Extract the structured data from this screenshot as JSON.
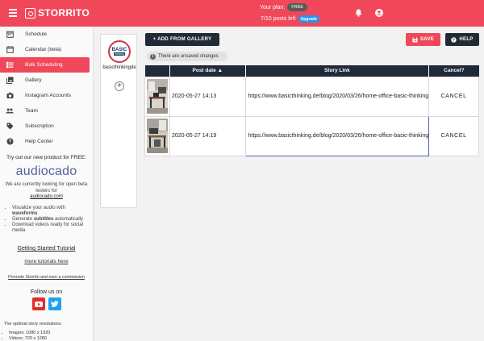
{
  "app": {
    "brand": "STORRITO"
  },
  "topbar": {
    "plan_label": "Your plan:",
    "plan_badge": "FREE",
    "posts_left": "7/10 posts left",
    "upgrade_label": "Upgrade",
    "accent": "#f0485a"
  },
  "sidebar": {
    "items": [
      {
        "label": "Schedule",
        "icon": "schedule-icon"
      },
      {
        "label": "Calendar (beta)",
        "icon": "calendar-icon"
      },
      {
        "label": "Bulk Scheduling",
        "icon": "list-icon",
        "active": true
      },
      {
        "label": "Gallery",
        "icon": "gallery-icon"
      },
      {
        "label": "Instagram Accounts",
        "icon": "camera-icon"
      },
      {
        "label": "Team",
        "icon": "team-icon"
      },
      {
        "label": "Subscription",
        "icon": "tag-icon"
      },
      {
        "label": "Help Center",
        "icon": "help-icon"
      }
    ],
    "promo": {
      "title": "Try out our new product for FREE:",
      "logo_text": "audiocado",
      "text": "We are currently looking for open beta testers for",
      "link": "audiocado.com",
      "bullets": [
        {
          "pre": "Visualize your audio with ",
          "bold": "waveforms",
          "post": ""
        },
        {
          "pre": "Generate ",
          "bold": "subtitles",
          "post": " automatically"
        },
        {
          "pre": "Download videos ready for social media",
          "bold": "",
          "post": ""
        }
      ]
    },
    "getting_started": "Getting Started Tutorial",
    "more_tutorials": "more tutorials here",
    "promote": "Promote Storrito and earn a commission",
    "follow_us": "Follow us on",
    "resolutions_title": "The optimal story resolutions:",
    "resolutions": [
      "Images: 1080 x 1920",
      "Videos: 720 x 1280"
    ]
  },
  "account": {
    "avatar_line1": "BASIC",
    "avatar_line2": "thinking",
    "name": "basicthinkingde"
  },
  "toolbar": {
    "add_gallery": "+ ADD FROM GALLERY",
    "save": "SAVE",
    "help": "HELP"
  },
  "status_chip": "There are unsaved changes",
  "table": {
    "headers": [
      "",
      "Post date ▲",
      "Story Link",
      "Cancel?"
    ],
    "rows": [
      {
        "date": "2020-05-27 14:13",
        "link": "https://www.basicthinking.de/blog/2020/03/26/home-office-basic-thinking",
        "cancel": "CANCEL"
      },
      {
        "date": "2020-05-27 14:19",
        "link": "https://www.basicthinking.de/blog/2020/03/26/home-office-basic-thinking",
        "cancel": "CANCEL"
      }
    ]
  }
}
